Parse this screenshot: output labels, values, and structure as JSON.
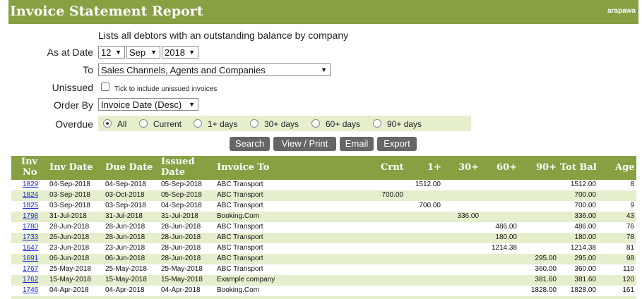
{
  "header": {
    "title": "Invoice Statement Report",
    "user": "arapawa"
  },
  "description": "Lists all debtors with an outstanding balance by company",
  "form": {
    "as_at_label": "As at Date",
    "day": "12",
    "month": "Sep",
    "year": "2018",
    "to_label": "To",
    "to_value": "Sales Channels, Agents and Companies",
    "unissued_label": "Unissued",
    "unissued_text": "Tick to include unissued invoices",
    "order_label": "Order By",
    "order_value": "Invoice Date (Desc)",
    "overdue_label": "Overdue",
    "overdue_options": [
      "All",
      "Current",
      "1+ days",
      "30+ days",
      "60+ days",
      "90+ days"
    ],
    "overdue_selected": "All"
  },
  "buttons": {
    "search": "Search",
    "view_print": "View / Print",
    "email": "Email",
    "export": "Export"
  },
  "table": {
    "headers": {
      "inv_no_1": "Inv",
      "inv_no_2": "No",
      "inv_date": "Inv Date",
      "due_date": "Due Date",
      "issued_1": "Issued",
      "issued_2": "Date",
      "invoice_to": "Invoice To",
      "crnt": "Crnt",
      "d1": "1+",
      "d30": "30+",
      "d60": "60+",
      "d90": "90+",
      "tot_bal": "Tot Bal",
      "age": "Age"
    },
    "rows": [
      {
        "inv_no": "1829",
        "inv_date": "04-Sep-2018",
        "due_date": "04-Sep-2018",
        "issued": "05-Sep-2018",
        "to": "ABC Transport",
        "crnt": "",
        "d1": "1512.00",
        "d30": "",
        "d60": "",
        "d90": "",
        "tot": "1512.00",
        "age": "8"
      },
      {
        "inv_no": "1824",
        "inv_date": "03-Sep-2018",
        "due_date": "03-Oct-2018",
        "issued": "05-Sep-2018",
        "to": "ABC Transport",
        "crnt": "700.00",
        "d1": "",
        "d30": "",
        "d60": "",
        "d90": "",
        "tot": "700.00",
        "age": ""
      },
      {
        "inv_no": "1825",
        "inv_date": "03-Sep-2018",
        "due_date": "03-Sep-2018",
        "issued": "04-Sep-2018",
        "to": "ABC Transport",
        "crnt": "",
        "d1": "700.00",
        "d30": "",
        "d60": "",
        "d90": "",
        "tot": "700.00",
        "age": "9"
      },
      {
        "inv_no": "1798",
        "inv_date": "31-Jul-2018",
        "due_date": "31-Jul-2018",
        "issued": "31-Jul-2018",
        "to": "Booking.Com",
        "crnt": "",
        "d1": "",
        "d30": "336.00",
        "d60": "",
        "d90": "",
        "tot": "336.00",
        "age": "43"
      },
      {
        "inv_no": "1780",
        "inv_date": "28-Jun-2018",
        "due_date": "28-Jun-2018",
        "issued": "28-Jun-2018",
        "to": "ABC Transport",
        "crnt": "",
        "d1": "",
        "d30": "",
        "d60": "486.00",
        "d90": "",
        "tot": "486.00",
        "age": "76"
      },
      {
        "inv_no": "1733",
        "inv_date": "26-Jun-2018",
        "due_date": "28-Jun-2018",
        "issued": "28-Jun-2018",
        "to": "ABC Transport",
        "crnt": "",
        "d1": "",
        "d30": "",
        "d60": "180.00",
        "d90": "",
        "tot": "180.00",
        "age": "78"
      },
      {
        "inv_no": "1647",
        "inv_date": "23-Jun-2018",
        "due_date": "23-Jun-2018",
        "issued": "28-Jun-2018",
        "to": "ABC Transport",
        "crnt": "",
        "d1": "",
        "d30": "",
        "d60": "1214.38",
        "d90": "",
        "tot": "1214.38",
        "age": "81"
      },
      {
        "inv_no": "1691",
        "inv_date": "06-Jun-2018",
        "due_date": "06-Jun-2018",
        "issued": "28-Jun-2018",
        "to": "ABC Transport",
        "crnt": "",
        "d1": "",
        "d30": "",
        "d60": "",
        "d90": "295.00",
        "tot": "295.00",
        "age": "98"
      },
      {
        "inv_no": "1767",
        "inv_date": "25-May-2018",
        "due_date": "25-May-2018",
        "issued": "25-May-2018",
        "to": "ABC Transport",
        "crnt": "",
        "d1": "",
        "d30": "",
        "d60": "",
        "d90": "360.00",
        "tot": "360.00",
        "age": "110"
      },
      {
        "inv_no": "1762",
        "inv_date": "15-May-2018",
        "due_date": "15-May-2018",
        "issued": "15-May-2018",
        "to": "Example company",
        "crnt": "",
        "d1": "",
        "d30": "",
        "d60": "",
        "d90": "381.60",
        "tot": "381.60",
        "age": "120"
      },
      {
        "inv_no": "1746",
        "inv_date": "04-Apr-2018",
        "due_date": "04-Apr-2018",
        "issued": "04-Apr-2018",
        "to": "Booking.Com",
        "crnt": "",
        "d1": "",
        "d30": "",
        "d60": "",
        "d90": "1828.00",
        "tot": "1828.00",
        "age": "161"
      }
    ]
  }
}
